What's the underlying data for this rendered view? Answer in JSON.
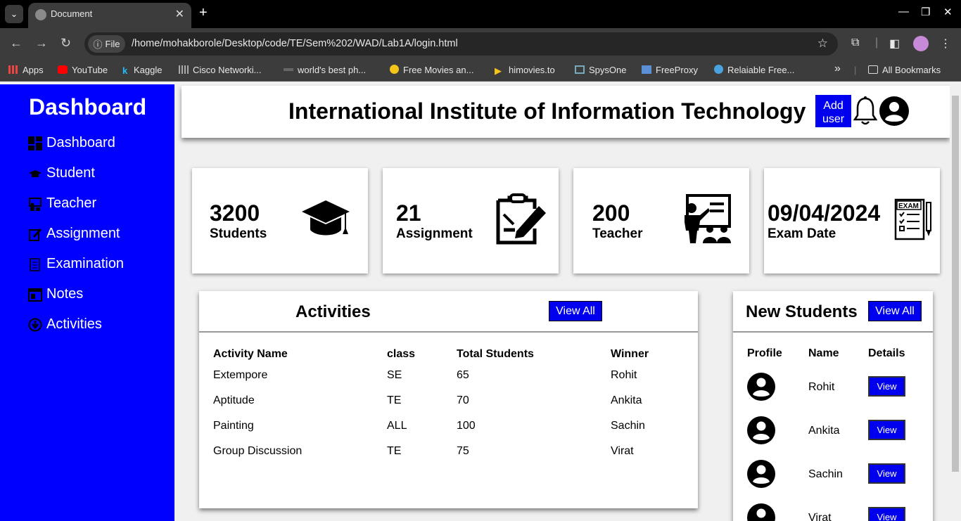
{
  "browser": {
    "tab_title": "Document",
    "url_chip": "File",
    "url": "/home/mohakborole/Desktop/code/TE/Sem%202/WAD/Lab1A/login.html",
    "bookmarks": [
      "Apps",
      "YouTube",
      "Kaggle",
      "Cisco Networki...",
      "world's best ph...",
      "Free Movies an...",
      "himovies.to",
      "SpysOne",
      "FreeProxy",
      "Relaiable Free..."
    ],
    "all_bookmarks": "All Bookmarks"
  },
  "sidebar": {
    "title": "Dashboard",
    "items": [
      {
        "label": "Dashboard",
        "icon": "dashboard-icon"
      },
      {
        "label": "Student",
        "icon": "graduation-cap-icon"
      },
      {
        "label": "Teacher",
        "icon": "teacher-icon"
      },
      {
        "label": "Assignment",
        "icon": "assignment-icon"
      },
      {
        "label": "Examination",
        "icon": "exam-icon"
      },
      {
        "label": "Notes",
        "icon": "notes-icon"
      },
      {
        "label": "Activities",
        "icon": "activities-icon"
      }
    ],
    "bg_color": "#0000ff"
  },
  "header": {
    "title": "International Institute of Information Technology",
    "add_user": "Add user"
  },
  "cards": [
    {
      "value": "3200",
      "label": "Students",
      "icon": "graduation-cap-icon"
    },
    {
      "value": "21",
      "label": "Assignment",
      "icon": "clipboard-edit-icon"
    },
    {
      "value": "200",
      "label": "Teacher",
      "icon": "teacher-board-icon"
    },
    {
      "value": "09/04/2024",
      "label": "Exam Date",
      "icon": "exam-paper-icon"
    }
  ],
  "activities": {
    "title": "Activities",
    "view_all": "View All",
    "columns": [
      "Activity Name",
      "class",
      "Total Students",
      "Winner"
    ],
    "rows": [
      [
        "Extempore",
        "SE",
        "65",
        "Rohit"
      ],
      [
        "Aptitude",
        "TE",
        "70",
        "Ankita"
      ],
      [
        "Painting",
        "ALL",
        "100",
        "Sachin"
      ],
      [
        "Group Discussion",
        "TE",
        "75",
        "Virat"
      ]
    ]
  },
  "new_students": {
    "title": "New Students",
    "view_all": "View All",
    "columns": [
      "Profile",
      "Name",
      "Details"
    ],
    "rows": [
      {
        "name": "Rohit",
        "button": "View"
      },
      {
        "name": "Ankita",
        "button": "View"
      },
      {
        "name": "Sachin",
        "button": "View"
      },
      {
        "name": "Virat",
        "button": "View"
      }
    ]
  },
  "colors": {
    "accent": "#0000ee"
  }
}
